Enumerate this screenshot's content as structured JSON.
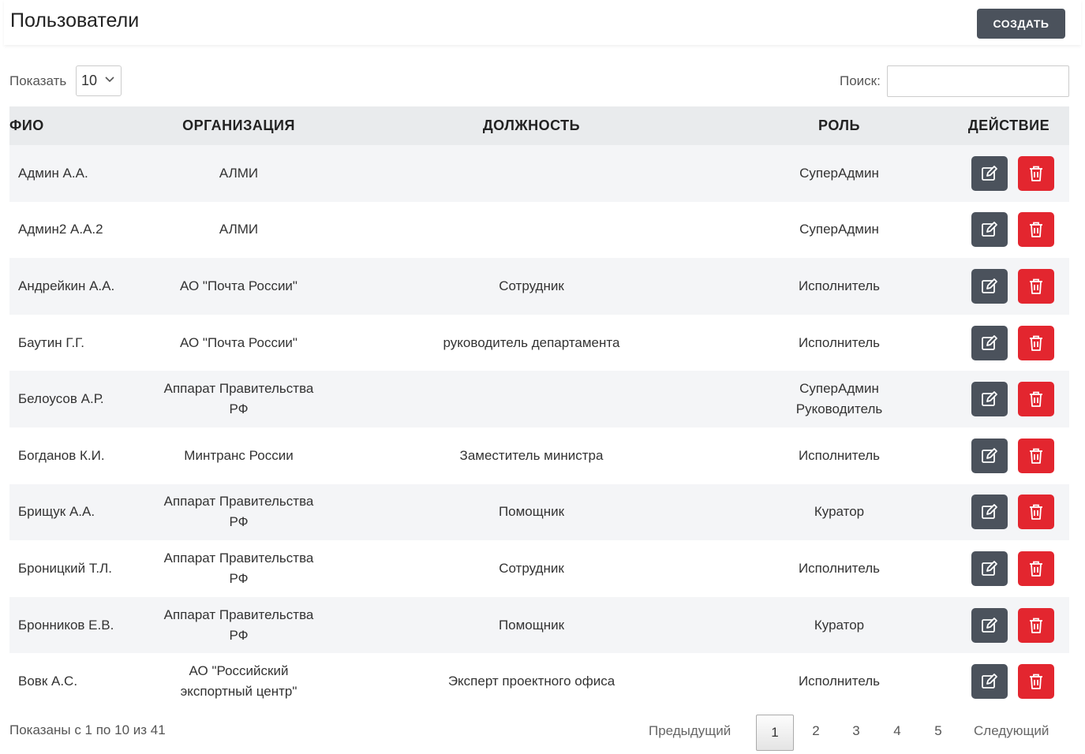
{
  "header": {
    "title": "Пользователи",
    "create_label": "СОЗДАТЬ"
  },
  "controls": {
    "show_label": "Показать",
    "page_length": "10",
    "search_label": "Поиск:",
    "search_value": ""
  },
  "table": {
    "columns": [
      "ФИО",
      "ОРГАНИЗАЦИЯ",
      "ДОЛЖНОСТЬ",
      "РОЛЬ",
      "ДЕЙСТВИЕ"
    ],
    "rows": [
      {
        "name": "Админ А.А.",
        "org": "АЛМИ",
        "position": "",
        "roles": [
          "СуперАдмин"
        ]
      },
      {
        "name": "Админ2 А.А.2",
        "org": "АЛМИ",
        "position": "",
        "roles": [
          "СуперАдмин"
        ]
      },
      {
        "name": "Андрейкин А.А.",
        "org": "АО \"Почта России\"",
        "position": "Сотрудник",
        "roles": [
          "Исполнитель"
        ]
      },
      {
        "name": "Баутин Г.Г.",
        "org": "АО \"Почта России\"",
        "position": "руководитель департамента",
        "roles": [
          "Исполнитель"
        ]
      },
      {
        "name": "Белоусов А.Р.",
        "org": "Аппарат Правительства РФ",
        "position": "",
        "roles": [
          "СуперАдмин",
          "Руководитель"
        ]
      },
      {
        "name": "Богданов К.И.",
        "org": "Минтранс России",
        "position": "Заместитель министра",
        "roles": [
          "Исполнитель"
        ]
      },
      {
        "name": "Брищук А.А.",
        "org": "Аппарат Правительства РФ",
        "position": "Помощник",
        "roles": [
          "Куратор"
        ]
      },
      {
        "name": "Броницкий Т.Л.",
        "org": "Аппарат Правительства РФ",
        "position": "Сотрудник",
        "roles": [
          "Исполнитель"
        ]
      },
      {
        "name": "Бронников Е.В.",
        "org": "Аппарат Правительства РФ",
        "position": "Помощник",
        "roles": [
          "Куратор"
        ]
      },
      {
        "name": "Вовк А.С.",
        "org": "АО \"Российский экспортный центр\"",
        "position": "Эксперт проектного офиса",
        "roles": [
          "Исполнитель"
        ]
      }
    ]
  },
  "footer": {
    "info": "Показаны с 1 по 10 из 41",
    "prev_label": "Предыдущий",
    "next_label": "Следующий",
    "pages": [
      "1",
      "2",
      "3",
      "4",
      "5"
    ],
    "current_page": "1"
  },
  "icons": {
    "edit": "edit-icon",
    "delete": "trash-icon",
    "select": "chevron-down-icon"
  },
  "colors": {
    "dark_button": "#4b525c",
    "delete_button": "#e3262f",
    "header_row": "#e9ebed"
  }
}
